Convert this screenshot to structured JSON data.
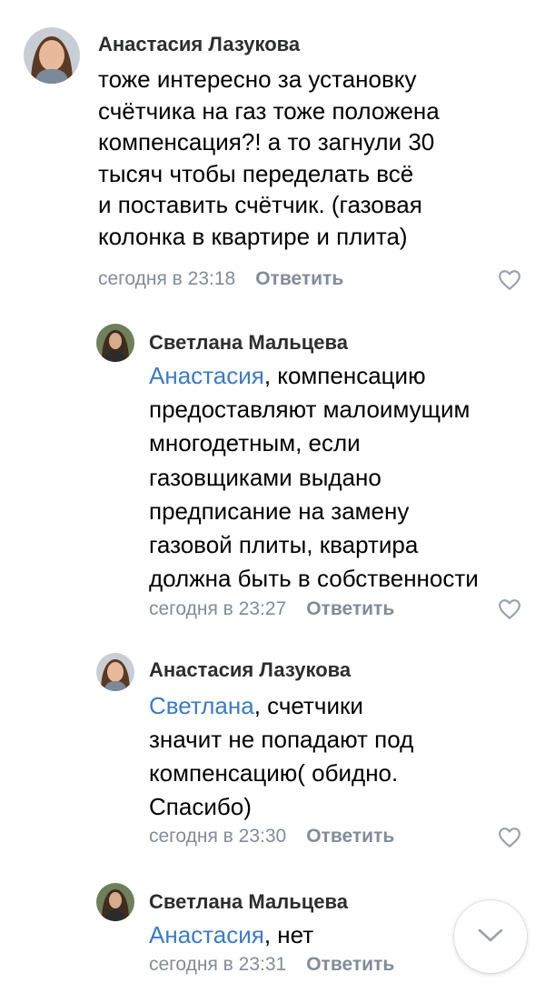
{
  "comments": [
    {
      "author": "Анастасия Лазукова",
      "text_lines": [
        "тоже интересно за установку",
        "счётчика на газ тоже положена",
        "компенсация?! а то загнули 30",
        "тысяч чтобы переделать всё",
        "и поставить счётчик. (газовая",
        "колонка в квартире и плита)"
      ],
      "time": "сегодня в 23:18",
      "reply_label": "Ответить"
    },
    {
      "author": "Светлана Мальцева",
      "mention": "Анастасия",
      "text_first_rest": ", компенсацию",
      "text_lines": [
        "предоставляют малоимущим",
        "многодетным, если",
        "газовщиками выдано",
        "предписание на замену",
        "газовой плиты, квартира",
        "должна быть в собственности"
      ],
      "time": "сегодня в 23:27",
      "reply_label": "Ответить"
    },
    {
      "author": "Анастасия Лазукова",
      "mention": "Светлана",
      "text_first_rest": ", счетчики",
      "text_lines": [
        "значит не попадают под",
        "компенсацию( обидно.",
        "Спасибо)"
      ],
      "time": "сегодня в 23:30",
      "reply_label": "Ответить"
    },
    {
      "author": "Светлана Мальцева",
      "mention": "Анастасия",
      "text_first_rest": ", нет",
      "text_lines": [],
      "time": "сегодня в 23:31",
      "reply_label": "Ответить"
    }
  ],
  "colors": {
    "mention": "#3b7bc4",
    "meta": "#818c99",
    "author": "#2c2d2e"
  },
  "icons": {
    "like": "heart-outline-icon",
    "scroll": "chevron-down-icon"
  }
}
